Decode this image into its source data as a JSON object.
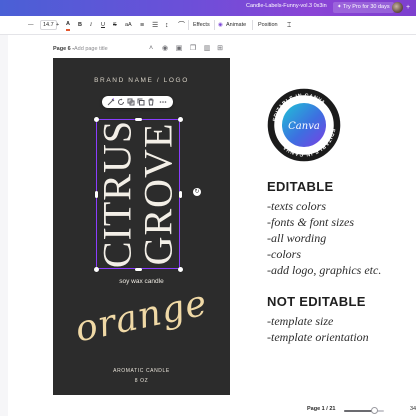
{
  "topbar": {
    "document_title": "Candle-Labels-Funny-vol.3 0x3in",
    "try_pro_label": "✦ Try Pro for 30 days",
    "avatar_icon": "user-avatar",
    "add_icon": "plus-icon",
    "gradient": [
      "#4a60d6",
      "#8a44d6"
    ]
  },
  "toolbar": {
    "font_size": "14.7",
    "minus_label": "—",
    "plus_label": "+",
    "text_color_icon": "A",
    "bold_label": "B",
    "italic_label": "I",
    "underline_label": "U",
    "strike_label": "S",
    "case_label": "aA",
    "effects_label": "Effects",
    "animate_label": "Animate",
    "position_label": "Position"
  },
  "pagebar": {
    "page_label": "Page 6 -",
    "page_title_placeholder": "Add page title"
  },
  "card": {
    "background": "#2c2c2c",
    "brand": "BRAND NAME / LOGO",
    "title_line1": "CITRUS",
    "title_line2": "GROVE",
    "subtitle": "soy wax candle",
    "scent": "orange",
    "scent_color": "#f0d9a6",
    "footer_line1": "AROMATIC CANDLE",
    "footer_line2": "8 OZ",
    "selection_color": "#8b3dff"
  },
  "badge": {
    "ring_text": "EDITABLE IN CANVA",
    "logo_text": "Canva",
    "star": "★"
  },
  "info": {
    "editable_heading": "EDITABLE",
    "editable_items": [
      "-texts colors",
      "-fonts & font sizes",
      "-all wording",
      "-colors",
      "-add logo, graphics etc."
    ],
    "not_editable_heading": "NOT EDITABLE",
    "not_editable_items": [
      "-template size",
      "-template orientation"
    ]
  },
  "status": {
    "page_indicator": "Page 1 / 21",
    "zoom_fraction": 0.75,
    "zoom_label": "34"
  }
}
